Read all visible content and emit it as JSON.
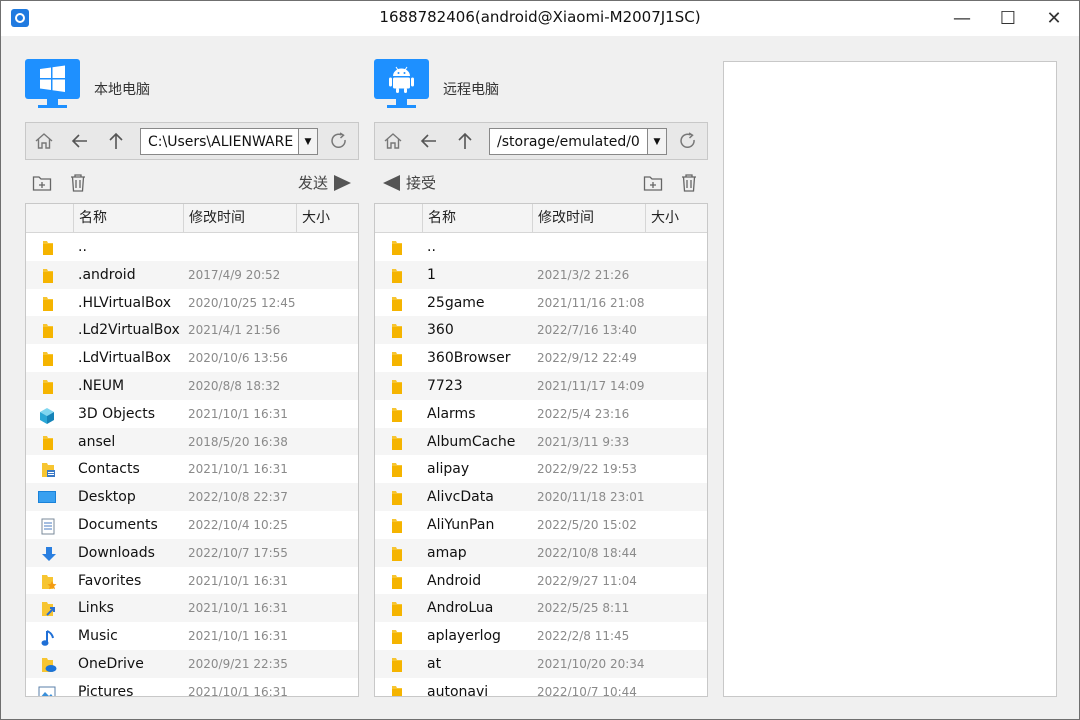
{
  "window": {
    "title": "1688782406(android@Xiaomi-M2007J1SC)",
    "min_glyph": "—",
    "max_glyph": "☐",
    "close_glyph": "✕"
  },
  "colors": {
    "accent": "#1e90ff",
    "folder": "#f7c531"
  },
  "local": {
    "title": "本地电脑",
    "os_icon": "windows-logo-icon",
    "path": "C:\\Users\\ALIENWARE",
    "send_label": "发送",
    "columns": [
      "名称",
      "修改时间",
      "大小"
    ],
    "rows": [
      {
        "name": "..",
        "date": "",
        "icon": "folder"
      },
      {
        "name": ".android",
        "date": "2017/4/9 20:52",
        "icon": "folder"
      },
      {
        "name": ".HLVirtualBox",
        "date": "2020/10/25 12:45",
        "icon": "folder"
      },
      {
        "name": ".Ld2VirtualBox",
        "date": "2021/4/1 21:56",
        "icon": "folder"
      },
      {
        "name": ".LdVirtualBox",
        "date": "2020/10/6 13:56",
        "icon": "folder"
      },
      {
        "name": ".NEUM",
        "date": "2020/8/8 18:32",
        "icon": "folder"
      },
      {
        "name": "3D Objects",
        "date": "2021/10/1 16:31",
        "icon": "cube"
      },
      {
        "name": "ansel",
        "date": "2018/5/20 16:38",
        "icon": "folder"
      },
      {
        "name": "Contacts",
        "date": "2021/10/1 16:31",
        "icon": "contacts"
      },
      {
        "name": "Desktop",
        "date": "2022/10/8 22:37",
        "icon": "desktop"
      },
      {
        "name": "Documents",
        "date": "2022/10/4 10:25",
        "icon": "document"
      },
      {
        "name": "Downloads",
        "date": "2022/10/7 17:55",
        "icon": "download"
      },
      {
        "name": "Favorites",
        "date": "2021/10/1 16:31",
        "icon": "star-folder"
      },
      {
        "name": "Links",
        "date": "2021/10/1 16:31",
        "icon": "link-folder"
      },
      {
        "name": "Music",
        "date": "2021/10/1 16:31",
        "icon": "music"
      },
      {
        "name": "OneDrive",
        "date": "2020/9/21 22:35",
        "icon": "cloud-folder"
      },
      {
        "name": "Pictures",
        "date": "2021/10/1 16:31",
        "icon": "picture"
      }
    ]
  },
  "remote": {
    "title": "远程电脑",
    "os_icon": "android-logo-icon",
    "path": "/storage/emulated/0",
    "receive_label": "接受",
    "columns": [
      "名称",
      "修改时间",
      "大小"
    ],
    "rows": [
      {
        "name": "..",
        "date": "",
        "icon": "folder"
      },
      {
        "name": "1",
        "date": "2021/3/2 21:26",
        "icon": "folder"
      },
      {
        "name": "25game",
        "date": "2021/11/16 21:08",
        "icon": "folder"
      },
      {
        "name": "360",
        "date": "2022/7/16 13:40",
        "icon": "folder"
      },
      {
        "name": "360Browser",
        "date": "2022/9/12 22:49",
        "icon": "folder"
      },
      {
        "name": "7723",
        "date": "2021/11/17 14:09",
        "icon": "folder"
      },
      {
        "name": "Alarms",
        "date": "2022/5/4 23:16",
        "icon": "folder"
      },
      {
        "name": "AlbumCache",
        "date": "2021/3/11 9:33",
        "icon": "folder"
      },
      {
        "name": "alipay",
        "date": "2022/9/22 19:53",
        "icon": "folder"
      },
      {
        "name": "AlivcData",
        "date": "2020/11/18 23:01",
        "icon": "folder"
      },
      {
        "name": "AliYunPan",
        "date": "2022/5/20 15:02",
        "icon": "folder"
      },
      {
        "name": "amap",
        "date": "2022/10/8 18:44",
        "icon": "folder"
      },
      {
        "name": "Android",
        "date": "2022/9/27 11:04",
        "icon": "folder"
      },
      {
        "name": "AndroLua",
        "date": "2022/5/25 8:11",
        "icon": "folder"
      },
      {
        "name": "aplayerlog",
        "date": "2022/2/8 11:45",
        "icon": "folder"
      },
      {
        "name": "at",
        "date": "2021/10/20 20:34",
        "icon": "folder"
      },
      {
        "name": "autonavi",
        "date": "2022/10/7 10:44",
        "icon": "folder"
      }
    ]
  }
}
